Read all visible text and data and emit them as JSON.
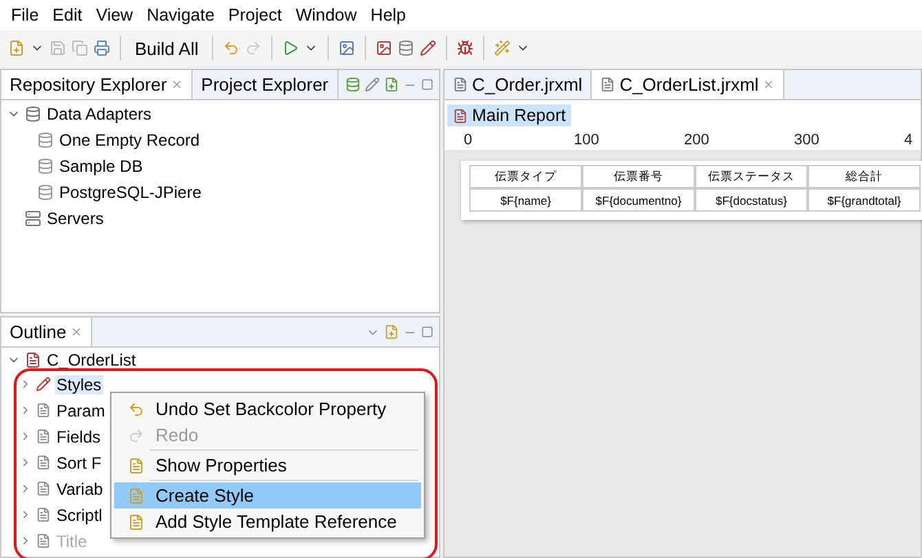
{
  "menu_bar": [
    "File",
    "Edit",
    "View",
    "Navigate",
    "Project",
    "Window",
    "Help"
  ],
  "toolbar": {
    "build_label": "Build All"
  },
  "left_tabs": [
    {
      "label": "Repository Explorer",
      "selected": true
    },
    {
      "label": "Project Explorer",
      "selected": false
    }
  ],
  "repository_tree": [
    {
      "label": "Data Adapters",
      "expanded": true,
      "children": [
        {
          "label": "One Empty Record"
        },
        {
          "label": "Sample DB"
        },
        {
          "label": "PostgreSQL-JPiere"
        }
      ]
    },
    {
      "label": "Servers"
    }
  ],
  "outline": {
    "title": "Outline",
    "root": "C_OrderList",
    "items": [
      {
        "label": "Styles",
        "selected": true,
        "disabled": false
      },
      {
        "label": "Param",
        "selected": false,
        "disabled": false
      },
      {
        "label": "Fields",
        "selected": false,
        "disabled": false
      },
      {
        "label": "Sort F",
        "selected": false,
        "disabled": false
      },
      {
        "label": "Variab",
        "selected": false,
        "disabled": false
      },
      {
        "label": "Scriptl",
        "selected": false,
        "disabled": false
      },
      {
        "label": "Title",
        "selected": false,
        "disabled": true
      }
    ]
  },
  "context_menu": [
    {
      "kind": "item",
      "label": "Undo Set Backcolor Property",
      "disabled": false,
      "selected": false
    },
    {
      "kind": "item",
      "label": "Redo",
      "disabled": true,
      "selected": false
    },
    {
      "kind": "separator"
    },
    {
      "kind": "item",
      "label": "Show Properties",
      "disabled": false,
      "selected": false
    },
    {
      "kind": "separator"
    },
    {
      "kind": "item",
      "label": "Create Style",
      "disabled": false,
      "selected": true
    },
    {
      "kind": "item",
      "label": "Add Style Template Reference",
      "disabled": false,
      "selected": false
    }
  ],
  "editor_tabs": [
    {
      "label": "C_Order.jrxml",
      "selected": false
    },
    {
      "label": "C_OrderList.jrxml",
      "selected": true
    }
  ],
  "breadcrumb": "Main Report",
  "ruler": [
    "0",
    "100",
    "200",
    "300",
    "4"
  ],
  "report_table": {
    "columns": [
      "伝票タイプ",
      "伝票番号",
      "伝票ステータス",
      "総合計"
    ],
    "row": [
      "$F{name}",
      "$F{documentno}",
      "$F{docstatus}",
      "$F{grandtotal}"
    ]
  }
}
